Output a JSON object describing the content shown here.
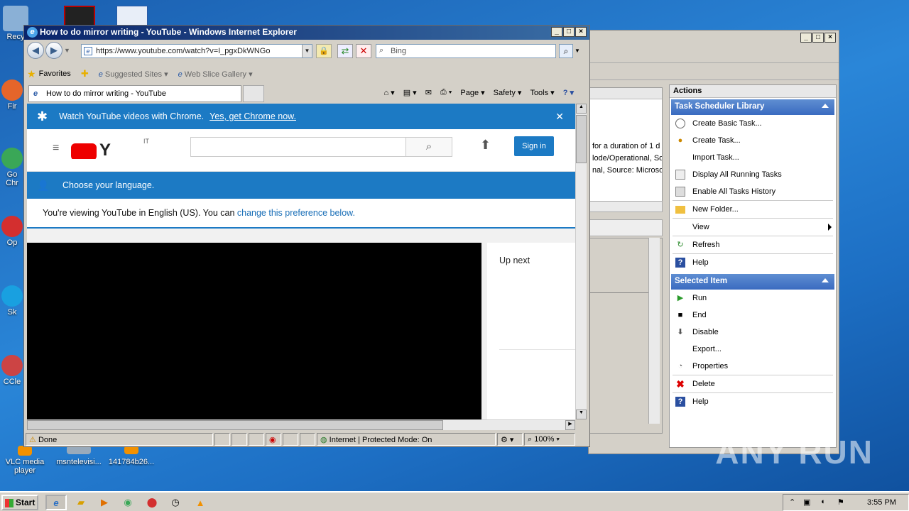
{
  "desktop": {
    "icons": [
      {
        "label": "Recy",
        "color": "#8ab0d6"
      },
      {
        "label": "Fir",
        "color": "#e5652a"
      },
      {
        "label": "Go\nChr",
        "color": "#3aa757"
      },
      {
        "label": "Op",
        "color": "#d32f2f"
      },
      {
        "label": "Sk",
        "color": "#19a0e0"
      },
      {
        "label": "CCle",
        "color": "#c44"
      },
      {
        "label": "VLC media player",
        "color": "#f29100"
      },
      {
        "label": "msntelevisi...",
        "color": "#9ab"
      },
      {
        "label": "141784b26...",
        "color": "#f29100"
      }
    ]
  },
  "task_scheduler": {
    "pane_text": [
      "for a duration of 1 d",
      "lode/Operational, So",
      "nal, Source: Microsof"
    ],
    "actions_header": "Actions",
    "library_section": "Task Scheduler Library",
    "library_items": [
      {
        "label": "Create Basic Task...",
        "icon": "clock-icon"
      },
      {
        "label": "Create Task...",
        "icon": "task-icon"
      },
      {
        "label": "Import Task...",
        "icon": ""
      },
      {
        "label": "Display All Running Tasks",
        "icon": "list-icon"
      },
      {
        "label": "Enable All Tasks History",
        "icon": "history-icon"
      },
      {
        "label": "New Folder...",
        "icon": "folder-icon"
      },
      {
        "label": "View",
        "icon": ""
      },
      {
        "label": "Refresh",
        "icon": "refresh-icon"
      },
      {
        "label": "Help",
        "icon": "help-icon"
      }
    ],
    "selected_section": "Selected Item",
    "selected_items": [
      {
        "label": "Run",
        "icon": "play-icon"
      },
      {
        "label": "End",
        "icon": "stop-icon"
      },
      {
        "label": "Disable",
        "icon": "down-arrow-icon"
      },
      {
        "label": "Export...",
        "icon": ""
      },
      {
        "label": "Properties",
        "icon": "properties-icon"
      },
      {
        "label": "Delete",
        "icon": "delete-icon"
      },
      {
        "label": "Help",
        "icon": "help-icon"
      }
    ]
  },
  "ie": {
    "title": "How to do mirror writing - YouTube - Windows Internet Explorer",
    "address": "https://www.youtube.com/watch?v=I_pgxDkWNGo",
    "search_placeholder": "Bing",
    "favorites_label": "Favorites",
    "suggested_sites": "Suggested Sites",
    "web_slice": "Web Slice Gallery",
    "tab_title": "How to do mirror writing - YouTube",
    "commands": {
      "page": "Page",
      "safety": "Safety",
      "tools": "Tools"
    },
    "status_text": "Done",
    "zone_text": "Internet | Protected Mode: On",
    "zoom": "100%"
  },
  "youtube": {
    "chrome_banner_text": "Watch YouTube videos with Chrome.",
    "chrome_banner_link": "Yes, get Chrome now.",
    "logo_suffix": "IT",
    "sign_in": "Sign in",
    "language_title": "Choose your language.",
    "language_msg_prefix": "You're viewing YouTube in English (US). You can ",
    "language_msg_link": "change this preference below.",
    "up_next": "Up next"
  },
  "taskbar": {
    "start_label": "Start",
    "clock": "3:55 PM"
  },
  "watermark": "ANY RUN"
}
